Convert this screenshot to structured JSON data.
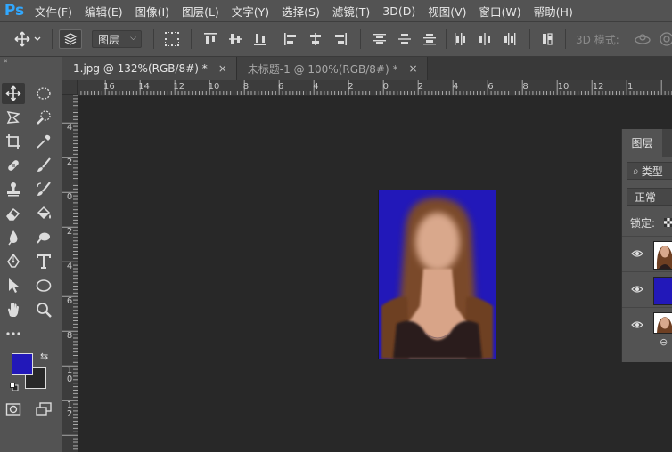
{
  "app": {
    "logo_text": "Ps"
  },
  "menu": [
    "文件(F)",
    "编辑(E)",
    "图像(I)",
    "图层(L)",
    "文字(Y)",
    "选择(S)",
    "滤镜(T)",
    "3D(D)",
    "视图(V)",
    "窗口(W)",
    "帮助(H)"
  ],
  "options_bar": {
    "auto_select_value": "图层",
    "mode_3d_label": "3D 模式:"
  },
  "tabs": [
    {
      "label": "1.jpg @ 132%(RGB/8#) *",
      "close": "×",
      "active": true
    },
    {
      "label": "未标题-1 @ 100%(RGB/8#) *",
      "close": "×",
      "active": false
    }
  ],
  "rulers": {
    "horizontal": [
      "16",
      "14",
      "12",
      "10",
      "8",
      "6",
      "4",
      "2",
      "0",
      "2",
      "4",
      "6",
      "8",
      "10",
      "12",
      "1"
    ],
    "vertical": [
      "4",
      "2",
      "0",
      "2",
      "4",
      "6",
      "8",
      "1\n0",
      "1\n2"
    ]
  },
  "colors": {
    "foreground": "#2218b9",
    "background": "#282828",
    "document_background": "#2218b9"
  },
  "layers_panel": {
    "tab_label": "图层",
    "filter_label": "类型",
    "blend_mode": "正常",
    "lock_label": "锁定:",
    "layers": [
      {
        "thumb": "portrait",
        "visible": true
      },
      {
        "thumb": "blue-fill",
        "visible": true
      },
      {
        "thumb": "portrait",
        "visible": true
      }
    ]
  }
}
